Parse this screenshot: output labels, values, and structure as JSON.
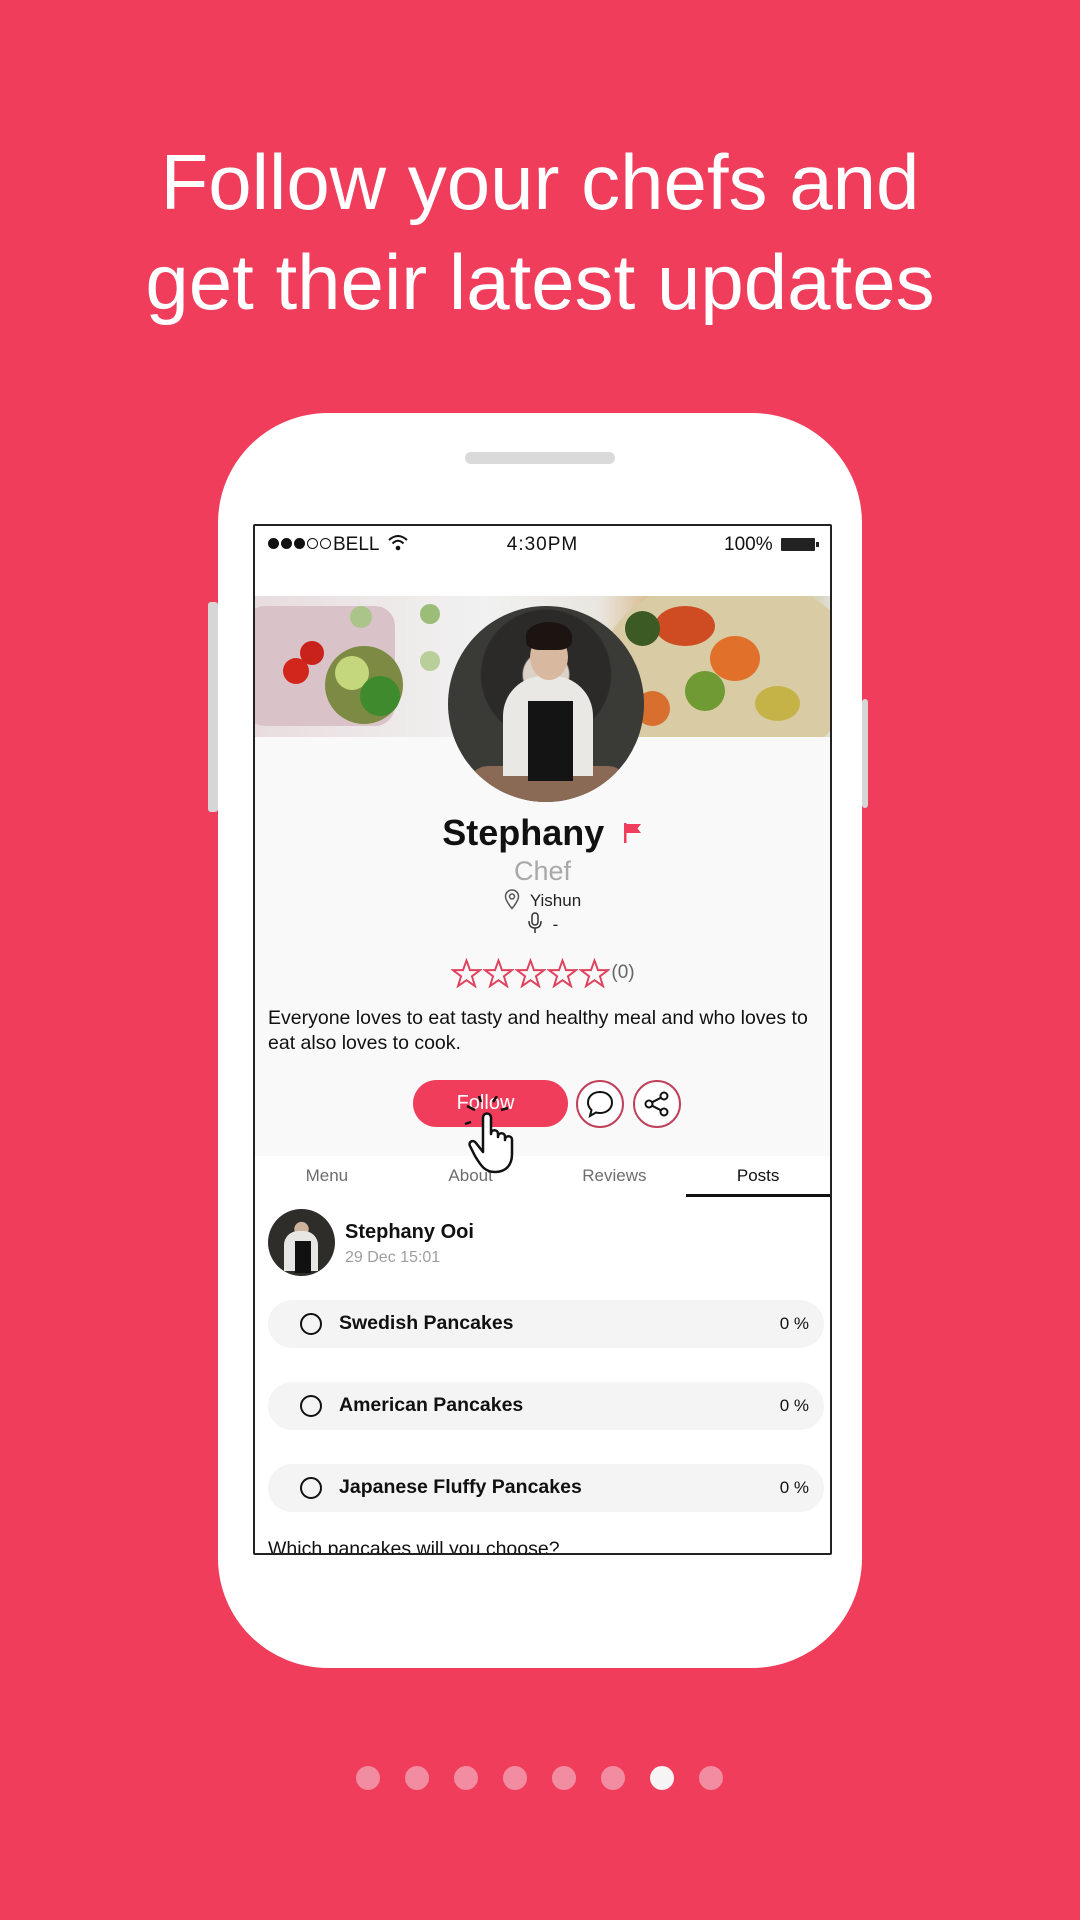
{
  "headline": {
    "line1": "Follow your chefs and",
    "line2": "get their latest updates"
  },
  "colors": {
    "background": "#EF3D5B",
    "accent": "#EF3D5B",
    "dot_inactive": "#F28CA0",
    "dot_active": "#F6F4F4"
  },
  "status_bar": {
    "signal_bars_filled": 3,
    "signal_bars_total": 5,
    "carrier": "BELL",
    "time": "4:30PM",
    "battery": "100%",
    "icons": [
      "signal-icon",
      "wifi-icon",
      "battery-icon"
    ]
  },
  "profile": {
    "name": "Stephany",
    "role": "Chef",
    "location": "Yishun",
    "language": "-",
    "rating_stars": 0,
    "rating_max": 5,
    "rating_count": "(0)",
    "bio": "Everyone loves to eat tasty and healthy meal and who loves to eat also loves to cook.",
    "follow_label": "Follow",
    "icons": [
      "flag-icon",
      "location-pin-icon",
      "microphone-icon",
      "chat-icon",
      "share-icon",
      "hand-cursor-icon"
    ]
  },
  "tabs": [
    {
      "label": "Menu",
      "active": false
    },
    {
      "label": "About",
      "active": false
    },
    {
      "label": "Reviews",
      "active": false
    },
    {
      "label": "Posts",
      "active": true
    }
  ],
  "post": {
    "author": "Stephany Ooi",
    "date": "29 Dec 15:01",
    "poll_options": [
      {
        "label": "Swedish Pancakes",
        "percent": "0 %"
      },
      {
        "label": "American Pancakes",
        "percent": "0 %"
      },
      {
        "label": "Japanese Fluffy Pancakes",
        "percent": "0 %"
      }
    ],
    "question": "Which pancakes will you choose?"
  },
  "pagination": {
    "total": 8,
    "active_index": 6
  }
}
